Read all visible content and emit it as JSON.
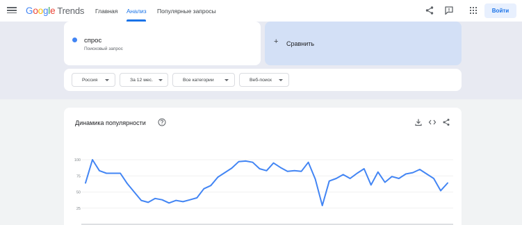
{
  "header": {
    "logo_google": [
      "G",
      "o",
      "o",
      "g",
      "l",
      "e"
    ],
    "logo_trends": "Trends",
    "nav": [
      "Главная",
      "Анализ",
      "Популярные запросы"
    ],
    "signin_label": "Войти"
  },
  "term": {
    "name": "спрос",
    "type": "Поисковый запрос",
    "color": "#4285f4"
  },
  "compare": {
    "icon": "+",
    "label": "Сравнить"
  },
  "filters": [
    "Россия",
    "За 12 мес.",
    "Все категории",
    "Веб-поиск"
  ],
  "chart_card": {
    "title": "Динамика популярности"
  },
  "colors": {
    "accent": "#1a73e8",
    "series": "#4285f4"
  },
  "chart_data": {
    "type": "line",
    "title": "Динамика популярности",
    "ylim": [
      0,
      100
    ],
    "y_ticks": [
      "100",
      "75",
      "50",
      "25"
    ],
    "grid": true,
    "series": [
      {
        "values": [
          64,
          100,
          83,
          79,
          79,
          79,
          63,
          50,
          37,
          34,
          40,
          38,
          33,
          37,
          35,
          38,
          41,
          55,
          60,
          73,
          80,
          87,
          97,
          98,
          96,
          86,
          83,
          95,
          88,
          82,
          83,
          82,
          96,
          70,
          29,
          67,
          71,
          77,
          71,
          79,
          86,
          61,
          81,
          65,
          74,
          71,
          78,
          80,
          85,
          78,
          71,
          52,
          64
        ]
      }
    ]
  }
}
